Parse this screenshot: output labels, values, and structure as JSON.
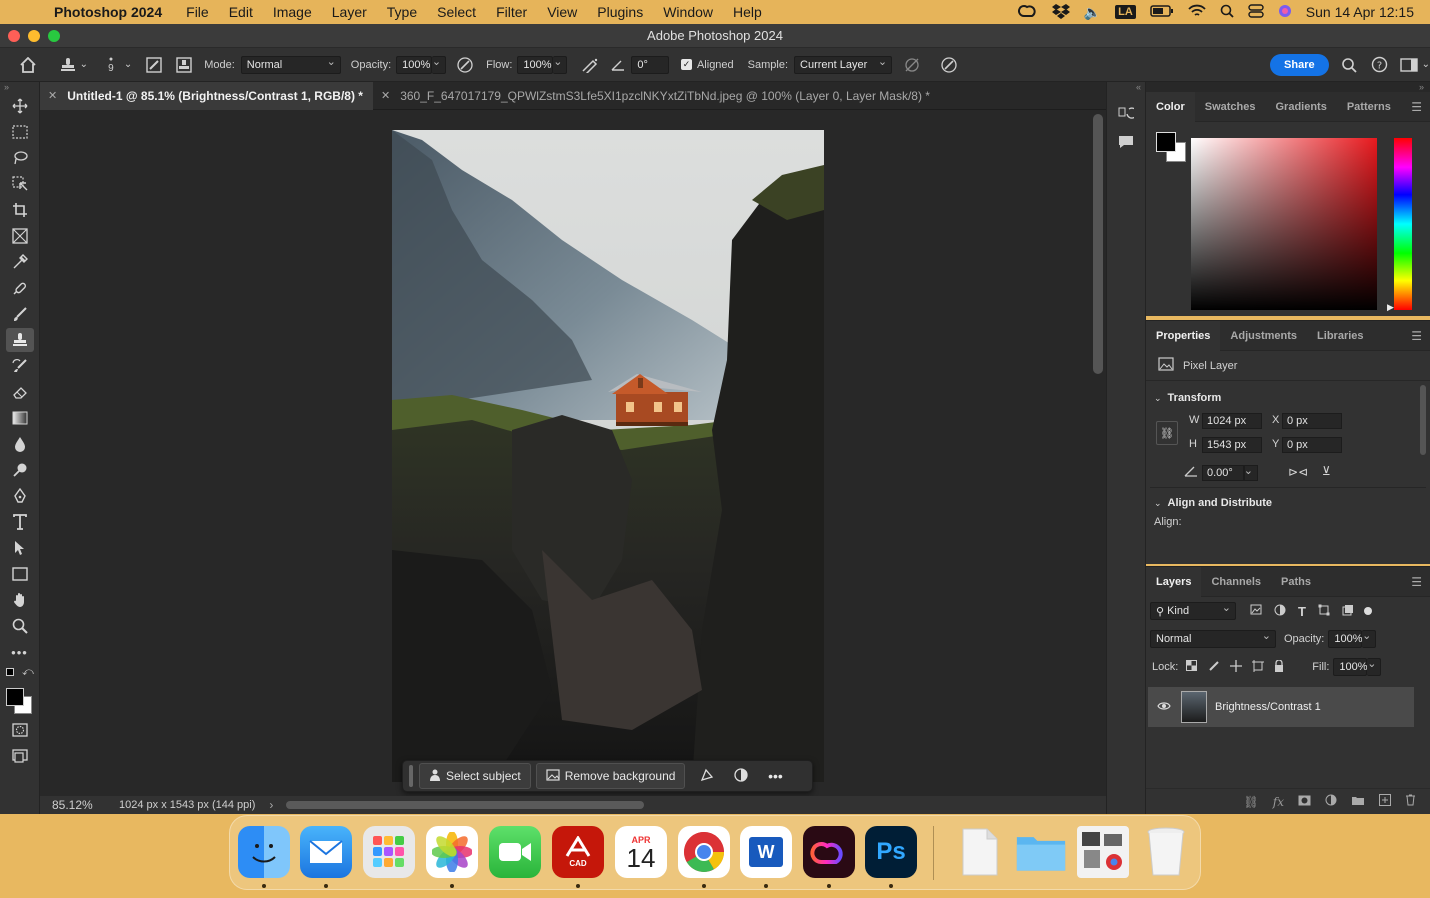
{
  "menubar": {
    "app_name": "Photoshop 2024",
    "items": [
      "File",
      "Edit",
      "Image",
      "Layer",
      "Type",
      "Select",
      "Filter",
      "View",
      "Plugins",
      "Window",
      "Help"
    ],
    "la_badge": "LA",
    "datetime": "Sun 14 Apr  12:15"
  },
  "window": {
    "title": "Adobe Photoshop 2024"
  },
  "options": {
    "brush_size": "9",
    "mode_label": "Mode:",
    "mode_value": "Normal",
    "opacity_label": "Opacity:",
    "opacity_value": "100%",
    "flow_label": "Flow:",
    "flow_value": "100%",
    "angle_value": "0°",
    "aligned_label": "Aligned",
    "aligned_checked": true,
    "sample_label": "Sample:",
    "sample_value": "Current Layer",
    "share_label": "Share"
  },
  "tabs": [
    {
      "label": "Untitled-1 @ 85.1% (Brightness/Contrast 1, RGB/8) *",
      "active": true
    },
    {
      "label": "360_F_647017179_QPWlZstmS3Lfe5XI1pzclNKYxtZiTbNd.jpeg @ 100% (Layer 0, Layer Mask/8) *",
      "active": false
    }
  ],
  "status": {
    "zoom": "85.12%",
    "doc_info": "1024 px x 1543 px (144 ppi)"
  },
  "contextbar": {
    "select_subject": "Select subject",
    "remove_background": "Remove background"
  },
  "color_panel": {
    "tabs": [
      "Color",
      "Swatches",
      "Gradients",
      "Patterns"
    ]
  },
  "properties_panel": {
    "tabs": [
      "Properties",
      "Adjustments",
      "Libraries"
    ],
    "layer_type": "Pixel Layer",
    "transform_title": "Transform",
    "w_label": "W",
    "w_value": "1024 px",
    "h_label": "H",
    "h_value": "1543 px",
    "x_label": "X",
    "x_value": "0 px",
    "y_label": "Y",
    "y_value": "0 px",
    "angle_value": "0.00°",
    "align_title": "Align and Distribute",
    "align_label": "Align:"
  },
  "layers_panel": {
    "tabs": [
      "Layers",
      "Channels",
      "Paths"
    ],
    "filter_kind": "Kind",
    "blend_mode": "Normal",
    "opacity_label": "Opacity:",
    "opacity_value": "100%",
    "lock_label": "Lock:",
    "fill_label": "Fill:",
    "fill_value": "100%",
    "layers": [
      {
        "name": "Brightness/Contrast 1",
        "visible": true
      }
    ]
  },
  "dock": {
    "calendar_month": "APR",
    "calendar_day": "14",
    "acrobat_label": "CAD",
    "photoshop_label": "Ps",
    "word_label": "W"
  },
  "colors": {
    "accent": "#1473e6",
    "panel": "#323232",
    "canvas_bg": "#282828"
  }
}
